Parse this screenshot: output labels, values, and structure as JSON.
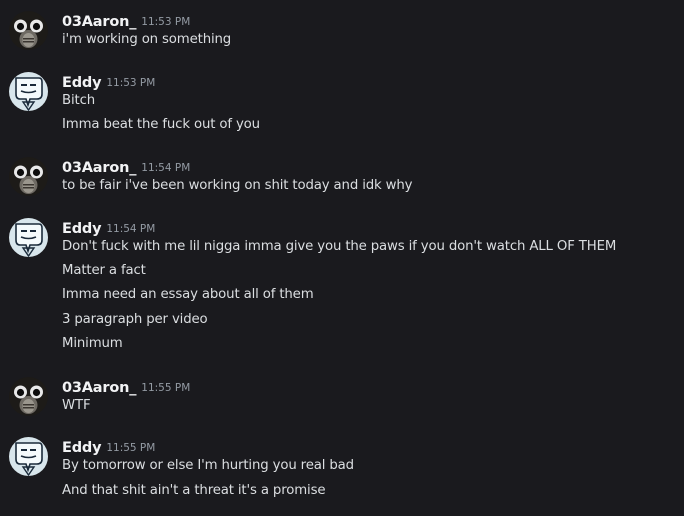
{
  "messages": [
    {
      "author": "03Aaron_",
      "time": "11:53 PM",
      "avatar": "aaron-avatar",
      "lines": [
        "i'm working on something"
      ]
    },
    {
      "author": "Eddy",
      "time": "11:53 PM",
      "avatar": "eddy-avatar",
      "lines": [
        "Bitch",
        "Imma beat the fuck out of you"
      ]
    },
    {
      "author": "03Aaron_",
      "time": "11:54 PM",
      "avatar": "aaron-avatar",
      "lines": [
        "to be fair i've been working on shit today and idk why"
      ]
    },
    {
      "author": "Eddy",
      "time": "11:54 PM",
      "avatar": "eddy-avatar",
      "lines": [
        "Don't fuck with me lil nigga imma give you the paws if you don't watch ALL OF THEM",
        "Matter a fact",
        "Imma need an essay about all of them",
        "3 paragraph per video",
        "Minimum"
      ]
    },
    {
      "author": "03Aaron_",
      "time": "11:55 PM",
      "avatar": "aaron-avatar",
      "lines": [
        "WTF"
      ]
    },
    {
      "author": "Eddy",
      "time": "11:55 PM",
      "avatar": "eddy-avatar",
      "lines": [
        "By tomorrow or else I'm hurting you real bad",
        "And that shit ain't a threat it's a promise"
      ]
    }
  ],
  "colors": {
    "background": "#1a1a1e",
    "username": "#f2f3f5",
    "timestamp": "#949ba4",
    "text": "#dbdee1"
  }
}
